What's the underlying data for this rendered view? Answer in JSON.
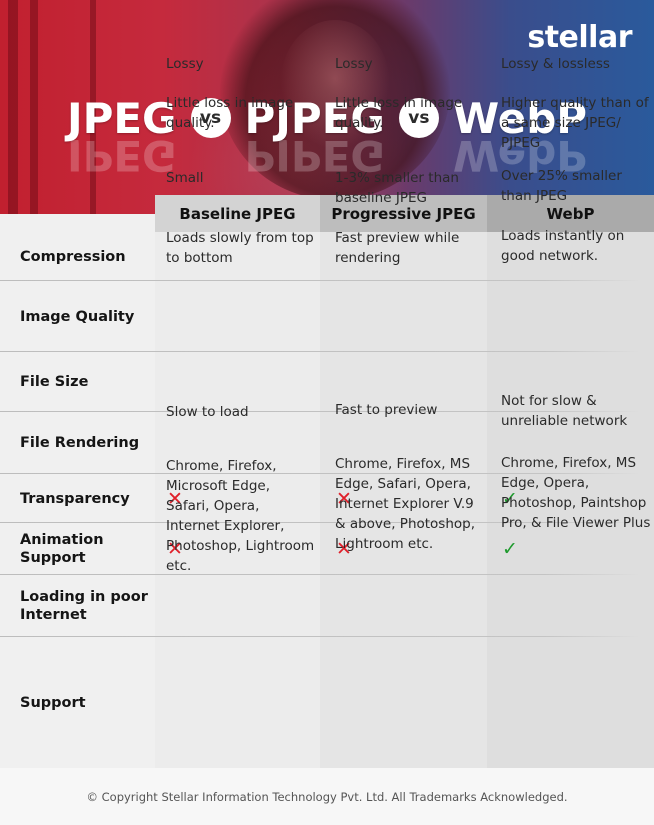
{
  "brand": {
    "logo_text": "stellar"
  },
  "title": {
    "words": [
      "JPEG",
      "PJPEG",
      "WebP"
    ],
    "separator": "vs"
  },
  "table": {
    "columns": [
      "Baseline JPEG",
      "Progressive JPEG",
      "WebP"
    ],
    "rows": [
      {
        "label": "Compression",
        "cells": [
          "Lossy",
          "Lossy",
          "Lossy & lossless"
        ]
      },
      {
        "label": "Image Quality",
        "cells": [
          "Little loss in image quality.",
          "Little loss in image quality.",
          "Higher quality than of a same size JPEG/ PJPEG"
        ]
      },
      {
        "label": "File Size",
        "cells": [
          "Small",
          "1-3% smaller than baseline JPEG",
          "Over 25% smaller than JPEG"
        ]
      },
      {
        "label": "File Rendering",
        "cells": [
          "Loads slowly from top to bottom",
          "Fast preview while rendering",
          "Loads instantly on good network."
        ]
      },
      {
        "label": "Transparency",
        "cells": [
          "cross-icon",
          "cross-icon",
          "check-icon"
        ]
      },
      {
        "label": "Animation Support",
        "cells": [
          "cross-icon",
          "cross-icon",
          "check-icon"
        ]
      },
      {
        "label": "Loading in poor Internet",
        "cells": [
          "Slow to load",
          "Fast to preview",
          "Not for slow & unreliable network"
        ]
      },
      {
        "label": "Support",
        "cells": [
          "Chrome, Firefox, Microsoft Edge, Safari, Opera, Internet Explorer, Photoshop, Lightroom etc.",
          "Chrome, Firefox, MS Edge, Safari, Opera, Internet Explorer V.9 & above, Photoshop, Lightroom etc.",
          "Chrome, Firefox, MS Edge, Opera, Photoshop, Paintshop Pro, & File Viewer Plus"
        ]
      }
    ],
    "icons": {
      "cross": "✕",
      "check": "✓"
    }
  },
  "colors": {
    "cross": "#e0202a",
    "check": "#1f9a2e",
    "hero_left": "#c1202f",
    "hero_right": "#2a5a9c"
  },
  "footer": {
    "copyright": "© Copyright Stellar Information Technology Pvt. Ltd. All Trademarks Acknowledged."
  }
}
